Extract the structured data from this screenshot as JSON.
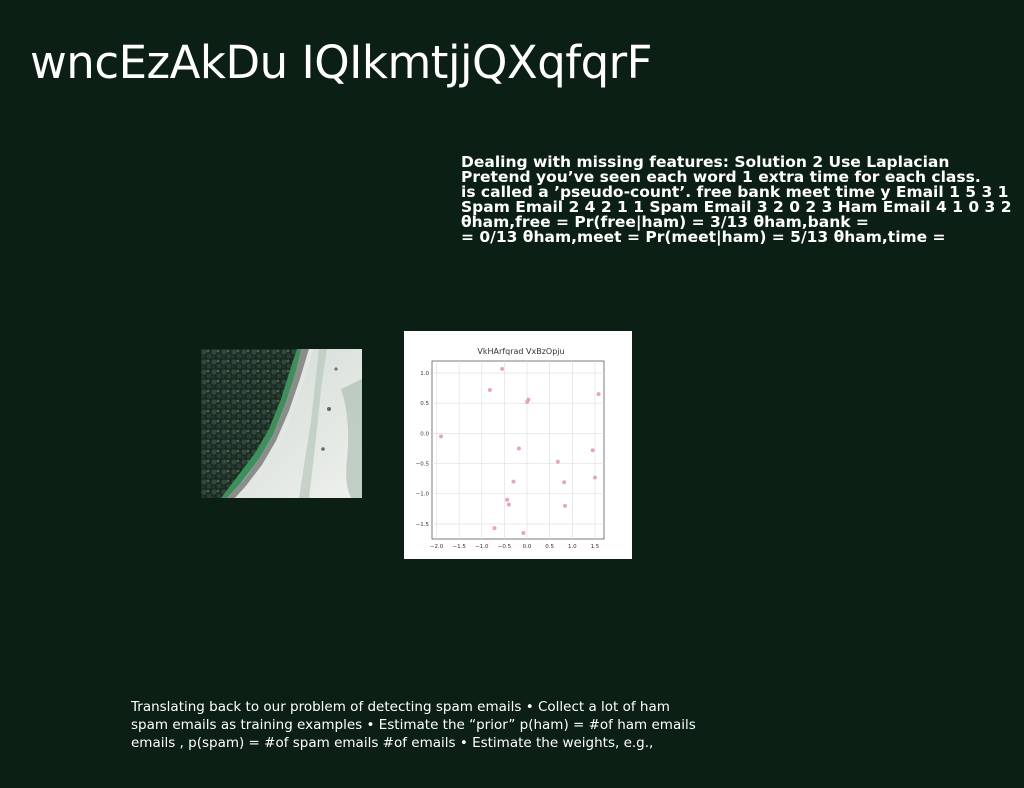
{
  "slide": {
    "title": "wncEzAkDu IQIkmtjjQXqfqrF",
    "body_lines": [
      "Dealing with missing features: Solution 2 Use Laplacian",
      "Pretend you’ve seen each word 1 extra time for each class.",
      "is called a ’pseudo-count’. free bank meet time y Email 1 5 3 1",
      "Spam Email 2 4 2 1 1 Spam Email 3 2 0 2 3 Ham Email 4 1 0 3 2",
      "θham,free = Pr(free|ham) = 3/13 θham,bank =",
      "= 0/13 θham,meet = Pr(meet|ham) = 5/13 θham,time ="
    ],
    "footer_lines": [
      "Translating back to our problem of detecting spam emails • Collect a lot of ham",
      "spam emails as training examples • Estimate the “prior” p(ham) = #of ham emails",
      "emails , p(spam) = #of spam emails #of emails • Estimate the weights, e.g.,"
    ]
  },
  "chart_data": {
    "type": "scatter",
    "title": "VkHArfqrad VxBzOpju",
    "xlabel": "",
    "ylabel": "",
    "xlim": [
      -2.1,
      1.7
    ],
    "ylim": [
      -1.75,
      1.2
    ],
    "xticks": [
      "−2.0",
      "−1.5",
      "−1.0",
      "−0.5",
      "0.0",
      "0.5",
      "1.0",
      "1.5"
    ],
    "xtick_values": [
      -2.0,
      -1.5,
      -1.0,
      -0.5,
      0.0,
      0.5,
      1.0,
      1.5
    ],
    "yticks": [
      "1.0",
      "0.5",
      "0.0",
      "−0.5",
      "−1.0",
      "−1.5"
    ],
    "ytick_values": [
      1.0,
      0.5,
      0.0,
      -0.5,
      -1.0,
      -1.5
    ],
    "grid": true,
    "point_color": "#e8a6b4",
    "x": [
      -0.55,
      -0.82,
      0.03,
      0.0,
      1.58,
      -1.9,
      -0.18,
      1.45,
      0.68,
      1.5,
      -0.3,
      0.82,
      -0.44,
      -0.4,
      0.84,
      -0.72,
      -0.08
    ],
    "y": [
      1.07,
      0.72,
      0.56,
      0.52,
      0.65,
      -0.05,
      -0.25,
      -0.28,
      -0.47,
      -0.73,
      -0.8,
      -0.81,
      -1.1,
      -1.18,
      -1.2,
      -1.57,
      -1.65
    ]
  }
}
